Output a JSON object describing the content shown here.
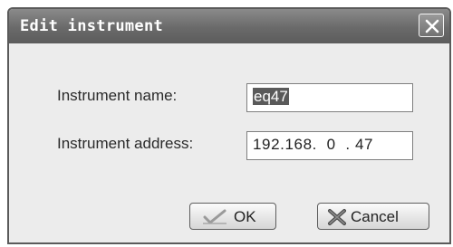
{
  "dialog": {
    "title": "Edit instrument",
    "close_icon": "close-icon"
  },
  "form": {
    "name_label": "Instrument name:",
    "name_value": "eq47",
    "address_label": "Instrument address:",
    "address_value": "192.168.  0  . 47"
  },
  "buttons": {
    "ok_label": "OK",
    "ok_icon": "checkmark-icon",
    "cancel_label": "Cancel",
    "cancel_icon": "x-icon"
  }
}
